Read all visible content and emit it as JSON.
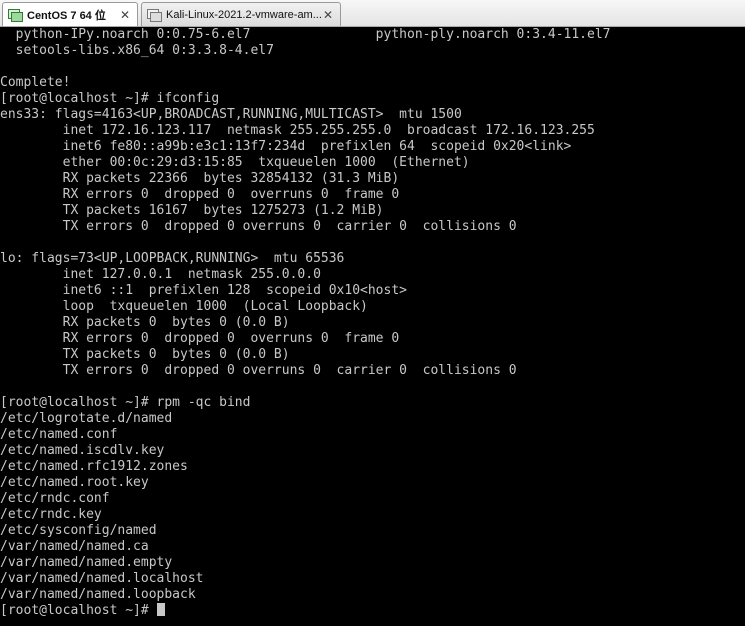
{
  "tabs": [
    {
      "label": "CentOS 7 64 位",
      "close": "✕",
      "active": true
    },
    {
      "label": "Kali-Linux-2021.2-vmware-am...",
      "close": "✕",
      "active": false
    }
  ],
  "terminal": {
    "lines": [
      "  python-IPy.noarch 0:0.75-6.el7                python-ply.noarch 0:3.4-11.el7",
      "  setools-libs.x86_64 0:3.3.8-4.el7",
      "",
      "Complete!",
      "[root@localhost ~]# ifconfig",
      "ens33: flags=4163<UP,BROADCAST,RUNNING,MULTICAST>  mtu 1500",
      "        inet 172.16.123.117  netmask 255.255.255.0  broadcast 172.16.123.255",
      "        inet6 fe80::a99b:e3c1:13f7:234d  prefixlen 64  scopeid 0x20<link>",
      "        ether 00:0c:29:d3:15:85  txqueuelen 1000  (Ethernet)",
      "        RX packets 22366  bytes 32854132 (31.3 MiB)",
      "        RX errors 0  dropped 0  overruns 0  frame 0",
      "        TX packets 16167  bytes 1275273 (1.2 MiB)",
      "        TX errors 0  dropped 0 overruns 0  carrier 0  collisions 0",
      "",
      "lo: flags=73<UP,LOOPBACK,RUNNING>  mtu 65536",
      "        inet 127.0.0.1  netmask 255.0.0.0",
      "        inet6 ::1  prefixlen 128  scopeid 0x10<host>",
      "        loop  txqueuelen 1000  (Local Loopback)",
      "        RX packets 0  bytes 0 (0.0 B)",
      "        RX errors 0  dropped 0  overruns 0  frame 0",
      "        TX packets 0  bytes 0 (0.0 B)",
      "        TX errors 0  dropped 0 overruns 0  carrier 0  collisions 0",
      "",
      "[root@localhost ~]# rpm -qc bind",
      "/etc/logrotate.d/named",
      "/etc/named.conf",
      "/etc/named.iscdlv.key",
      "/etc/named.rfc1912.zones",
      "/etc/named.root.key",
      "/etc/rndc.conf",
      "/etc/rndc.key",
      "/etc/sysconfig/named",
      "/var/named/named.ca",
      "/var/named/named.empty",
      "/var/named/named.localhost",
      "/var/named/named.loopback",
      "[root@localhost ~]# "
    ],
    "foreground_color": "#c8c8c8",
    "background_color": "#000000"
  }
}
